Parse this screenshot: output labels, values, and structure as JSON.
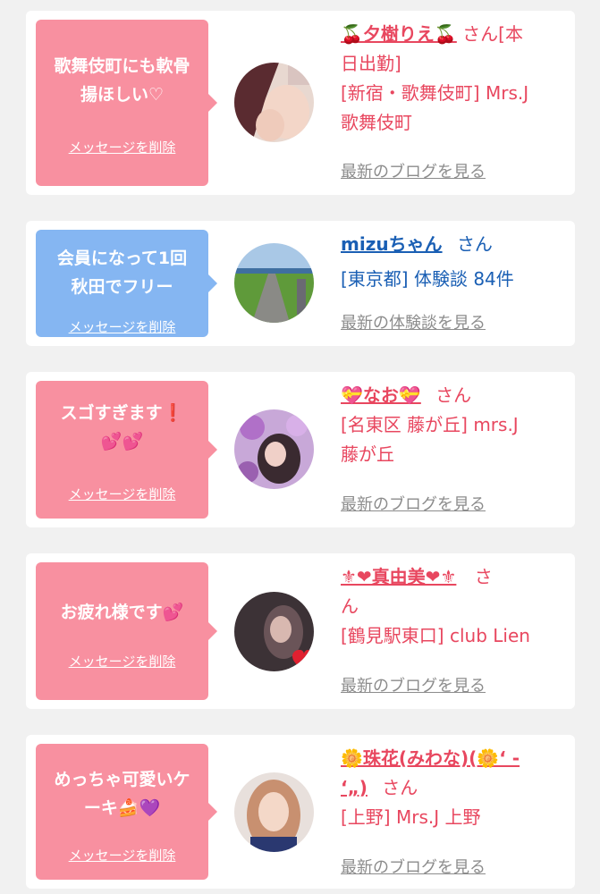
{
  "colors": {
    "pink": "#f890a0",
    "blue": "#85b6f2",
    "name_pink": "#e8475f",
    "name_blue": "#1a5fb4"
  },
  "delete_label": "メッセージを削除",
  "items": [
    {
      "message_line1": "歌舞伎町にも軟骨",
      "message_line2": "揚ほしい♡",
      "name": "🍒夕樹りえ🍒",
      "san": "さん[本",
      "detail_line1": "日出勤]",
      "detail_line2": "[新宿・歌舞伎町] Mrs.J",
      "detail_line3": "歌舞伎町",
      "link": "最新のブログを見る",
      "avatar_icon": "woman-photo-icon"
    },
    {
      "message_line1": "会員になって1回",
      "message_line2": "秋田でフリー",
      "name": "mizuちゃん",
      "san": "さん",
      "detail_line1": "[東京都] 体験談 84件",
      "link": "最新の体験談を見る",
      "avatar_icon": "landscape-road-icon"
    },
    {
      "message_line1": "スゴすぎます❗",
      "message_line2": "💕💕",
      "name": "💝なお💝",
      "san": "さん",
      "detail_line1": "[名東区 藤が丘] mrs.J",
      "detail_line2": "藤が丘",
      "link": "最新のブログを見る",
      "avatar_icon": "woman-flowers-icon"
    },
    {
      "message_line1": "お疲れ様です💕",
      "name": "⚜❤真由美❤⚜",
      "san": "さ",
      "detail_line1": "ん",
      "detail_line2": "[鶴見駅東口] club Lien",
      "link": "最新のブログを見る",
      "avatar_icon": "woman-heart-icon"
    },
    {
      "message_line1": "めっちゃ可愛いケ",
      "message_line2": "ーキ🍰💜",
      "name": "🌼珠花(みわな)(🌼‘ -",
      "name_line2": "‘„)",
      "san": "さん",
      "detail_line1": "[上野] Mrs.J 上野",
      "link": "最新のブログを見る",
      "avatar_icon": "woman-blonde-icon"
    }
  ]
}
